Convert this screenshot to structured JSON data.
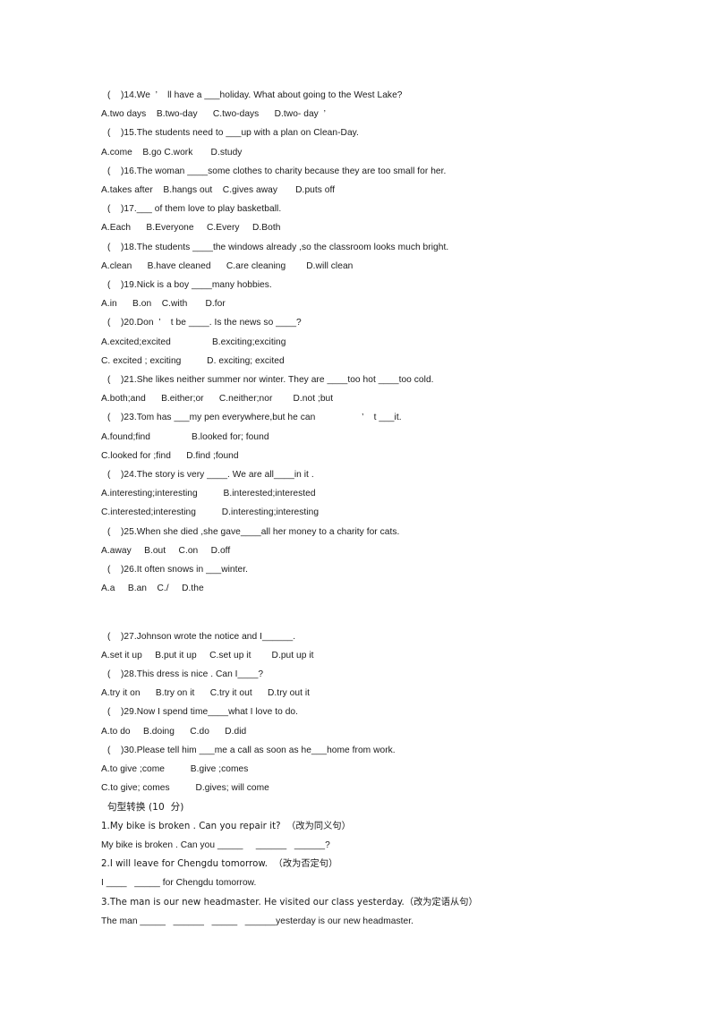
{
  "document": {
    "kind": "english-exam-worksheet",
    "page_background": "#ffffff",
    "text_color": "#1a1a1a"
  },
  "multiple_choice": {
    "items": [
      {
        "stem": "(    )14.We  ’    ll have a ___holiday. What about going to the West Lake?",
        "options": "A.two days    B.two-day      C.two-days      D.two- day  ’"
      },
      {
        "stem": "(    )15.The students need to ___up with a plan on Clean-Day.",
        "options": "A.come    B.go C.work       D.study"
      },
      {
        "stem": "(    )16.The woman ____some clothes to charity because they are too small for her.",
        "options": "A.takes after    B.hangs out    C.gives away       D.puts off"
      },
      {
        "stem": "(    )17.___ of them love to play basketball.",
        "options": "A.Each      B.Everyone     C.Every     D.Both"
      },
      {
        "stem": "(    )18.The students ____the windows already ,so the classroom looks much bright.",
        "options": "A.clean      B.have cleaned      C.are cleaning        D.will clean"
      },
      {
        "stem": "(    )19.Nick is a boy ____many hobbies.",
        "options": "A.in      B.on    C.with       D.for"
      },
      {
        "stem": "(    )20.Don  ’    t be ____. Is the news so ____?",
        "options": "A.excited;excited                B.exciting;exciting",
        "options2": "C. excited ; exciting          D. exciting; excited"
      },
      {
        "stem": "(    )21.She likes neither summer nor winter. They are ____too hot ____too cold.",
        "options": "A.both;and      B.either;or      C.neither;nor        D.not ;but"
      },
      {
        "stem": "(    )23.Tom has ___my pen everywhere,but he can                  ’    t ___it.",
        "options": "A.found;find                B.looked for; found",
        "options2": "C.looked for ;find      D.find ;found"
      },
      {
        "stem": "(    )24.The story is very ____. We are all____in it .",
        "options": "A.interesting;interesting          B.interested;interested",
        "options2": "C.interested;interesting          D.interesting;interesting"
      },
      {
        "stem": "(    )25.When she died ,she gave____all her money to a charity for cats.",
        "options": "A.away     B.out     C.on     D.off"
      },
      {
        "stem": "(    )26.It often snows in ___winter.",
        "options": "A.a     B.an    C./     D.the"
      },
      {
        "stem": "(    )27.Johnson wrote the notice and I______.",
        "options": "A.set it up     B.put it up     C.set up it        D.put up it"
      },
      {
        "stem": "(    )28.This dress is nice . Can I____?",
        "options": "A.try it on      B.try on it      C.try it out      D.try out it"
      },
      {
        "stem": "(    )29.Now I spend time____what I love to do.",
        "options": "A.to do     B.doing      C.do      D.did"
      },
      {
        "stem": "(    )30.Please tell him ___me a call as soon as he___home from work.",
        "options": "A.to give ;come          B.give ;comes",
        "options2": "C.to give; comes          D.gives; will come"
      }
    ]
  },
  "sentence_transformation": {
    "heading": "句型转换 (10  分)",
    "items": [
      {
        "prompt": "1.My bike is broken . Can you repair it?  （改为同义句）",
        "answer_line": "My bike is broken . Can you _____     ______   ______?"
      },
      {
        "prompt": "2.I will leave for Chengdu tomorrow.  （改为否定句）",
        "answer_line": "I ____   _____ for Chengdu tomorrow."
      },
      {
        "prompt": "3.The man is our new headmaster. He visited our class yesterday.（改为定语从句）",
        "answer_line": "The man _____   ______   _____   ______yesterday is our new headmaster."
      }
    ]
  }
}
